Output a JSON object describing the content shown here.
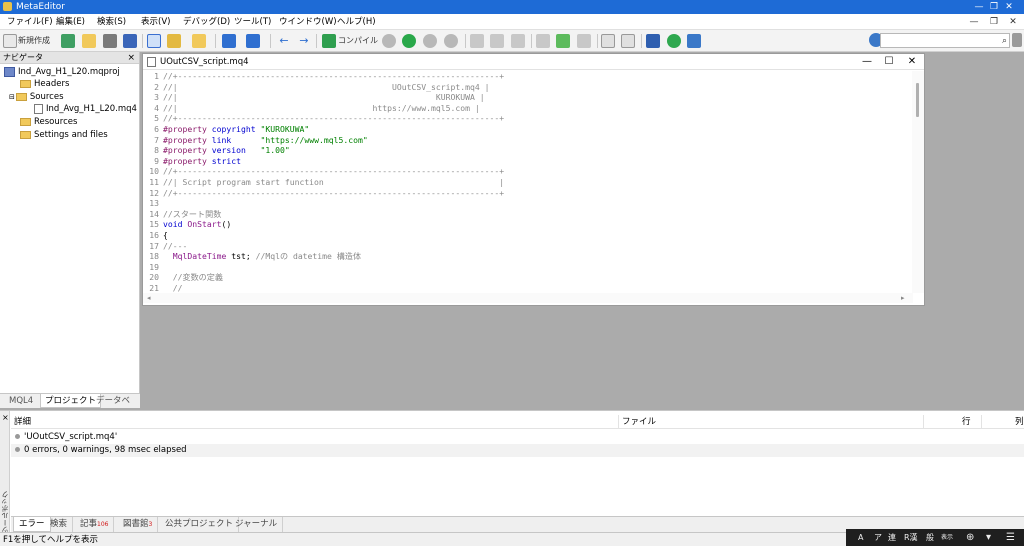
{
  "window": {
    "title": "MetaEditor",
    "minimize": "—",
    "restore": "❐",
    "close": "✕"
  },
  "menu": [
    "ファイル(F)",
    "編集(E)",
    "検索(S)",
    "表示(V)",
    "デバッグ(D)",
    "ツール(T)",
    "ウインドウ(W)",
    "ヘルプ(H)"
  ],
  "menu_controls": {
    "minimize": "—",
    "restore": "❐",
    "close": "✕"
  },
  "toolbar": {
    "new_label": "新規作成",
    "compile_label": "コンパイル",
    "search_placeholder": "",
    "search_icon": "⌕"
  },
  "navigator": {
    "title": "ナビゲータ",
    "close": "×",
    "project": "Ind_Avg_H1_L20.mqproj",
    "headers": "Headers",
    "sources": "Sources",
    "source_file": "Ind_Avg_H1_L20.mq4",
    "resources": "Resources",
    "settings": "Settings and files",
    "tabs": [
      "MQL4",
      "プロジェクト",
      "データベース"
    ]
  },
  "editor": {
    "title": "UOutCSV_script.mq4",
    "minimize": "—",
    "maximize": "☐",
    "close": "✕",
    "lines": [
      {
        "n": "1",
        "parts": [
          [
            "c-com",
            "//+------------------------------------------------------------------+"
          ]
        ]
      },
      {
        "n": "2",
        "parts": [
          [
            "c-com",
            "//|                                            UOutCSV_script.mq4 |"
          ]
        ]
      },
      {
        "n": "3",
        "parts": [
          [
            "c-com",
            "//|                                                     KUROKUWA |"
          ]
        ]
      },
      {
        "n": "4",
        "parts": [
          [
            "c-com",
            "//|                                        https://www.mql5.com |"
          ]
        ]
      },
      {
        "n": "5",
        "parts": [
          [
            "c-com",
            "//+------------------------------------------------------------------+"
          ]
        ]
      },
      {
        "n": "6",
        "parts": [
          [
            "c-pp",
            "#property"
          ],
          [
            "c-def",
            " "
          ],
          [
            "c-kw",
            "copyright"
          ],
          [
            "c-def",
            " "
          ],
          [
            "c-str",
            "\"KUROKUWA\""
          ]
        ]
      },
      {
        "n": "7",
        "parts": [
          [
            "c-pp",
            "#property"
          ],
          [
            "c-def",
            " "
          ],
          [
            "c-kw",
            "link"
          ],
          [
            "c-def",
            "      "
          ],
          [
            "c-str",
            "\"https://www.mql5.com\""
          ]
        ]
      },
      {
        "n": "8",
        "parts": [
          [
            "c-pp",
            "#property"
          ],
          [
            "c-def",
            " "
          ],
          [
            "c-kw",
            "version"
          ],
          [
            "c-def",
            "   "
          ],
          [
            "c-str",
            "\"1.00\""
          ]
        ]
      },
      {
        "n": "9",
        "parts": [
          [
            "c-pp",
            "#property"
          ],
          [
            "c-def",
            " "
          ],
          [
            "c-kw",
            "strict"
          ]
        ]
      },
      {
        "n": "10",
        "parts": [
          [
            "c-com",
            "//+------------------------------------------------------------------+"
          ]
        ]
      },
      {
        "n": "11",
        "parts": [
          [
            "c-com",
            "//| Script program start function                                    |"
          ]
        ]
      },
      {
        "n": "12",
        "parts": [
          [
            "c-com",
            "//+------------------------------------------------------------------+"
          ]
        ]
      },
      {
        "n": "13",
        "parts": [
          [
            "c-def",
            ""
          ]
        ]
      },
      {
        "n": "14",
        "parts": [
          [
            "c-com",
            "//スタート関数"
          ]
        ]
      },
      {
        "n": "15",
        "parts": [
          [
            "c-kw",
            "void"
          ],
          [
            "c-def",
            " "
          ],
          [
            "c-fn",
            "OnStart"
          ],
          [
            "c-def",
            "()"
          ]
        ]
      },
      {
        "n": "16",
        "parts": [
          [
            "c-def",
            "{"
          ]
        ]
      },
      {
        "n": "17",
        "parts": [
          [
            "c-com",
            "//---"
          ]
        ]
      },
      {
        "n": "18",
        "parts": [
          [
            "c-def",
            "  "
          ],
          [
            "c-ty",
            "MqlDateTime"
          ],
          [
            "c-def",
            " tst; "
          ],
          [
            "c-com",
            "//Mqlの datetime 構造体"
          ]
        ]
      },
      {
        "n": "19",
        "parts": [
          [
            "c-def",
            ""
          ]
        ]
      },
      {
        "n": "20",
        "parts": [
          [
            "c-def",
            "  "
          ],
          [
            "c-com",
            "//変数の定義"
          ]
        ]
      },
      {
        "n": "21",
        "parts": [
          [
            "c-def",
            "  "
          ],
          [
            "c-com",
            "//"
          ]
        ]
      }
    ]
  },
  "toolbox": {
    "vertical_title": "ツールボックス",
    "close": "×",
    "columns": {
      "detail": "詳細",
      "file": "ファイル",
      "line": "行",
      "col": "列"
    },
    "rows": [
      "'UOutCSV_script.mq4'",
      "0 errors, 0 warnings, 98 msec elapsed"
    ],
    "tabs": [
      {
        "label": "エラー",
        "badge": ""
      },
      {
        "label": "検索",
        "badge": ""
      },
      {
        "label": "記事",
        "badge": "106"
      },
      {
        "label": "図書館",
        "badge": "3"
      },
      {
        "label": "公共プロジェクト",
        "badge": ""
      },
      {
        "label": "ジャーナル",
        "badge": ""
      }
    ]
  },
  "statusbar": {
    "text": "F1を押してヘルプを表示"
  },
  "ime": {
    "a": "A",
    "ha": "ア",
    "ren": "連",
    "r": "R漢",
    "gen": "般",
    "small": "表示"
  },
  "colors": {
    "titlebar": "#1e6bd6",
    "workspace": "#ababab",
    "error_badge": "#d21818"
  }
}
